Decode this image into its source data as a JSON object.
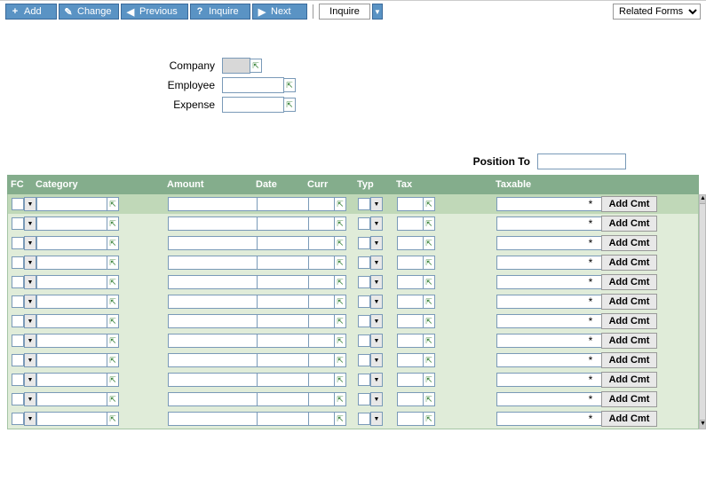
{
  "toolbar": {
    "add": "Add",
    "change": "Change",
    "previous": "Previous",
    "inquire": "Inquire",
    "next": "Next",
    "inquire2": "Inquire",
    "related_forms": "Related Forms"
  },
  "form": {
    "company_label": "Company",
    "employee_label": "Employee",
    "expense_label": "Expense",
    "company_value": "",
    "employee_value": "",
    "expense_value": ""
  },
  "position": {
    "label": "Position To",
    "value": ""
  },
  "grid": {
    "headers": {
      "fc": "FC",
      "category": "Category",
      "amount": "Amount",
      "date": "Date",
      "curr": "Curr",
      "typ": "Typ",
      "tax": "Tax",
      "taxable": "Taxable"
    },
    "add_cmt": "Add Cmt",
    "star": "*",
    "rows": [
      {
        "active": true
      },
      {
        "active": false
      },
      {
        "active": false
      },
      {
        "active": false
      },
      {
        "active": false
      },
      {
        "active": false
      },
      {
        "active": false
      },
      {
        "active": false
      },
      {
        "active": false
      },
      {
        "active": false
      },
      {
        "active": false
      },
      {
        "active": false
      }
    ]
  }
}
